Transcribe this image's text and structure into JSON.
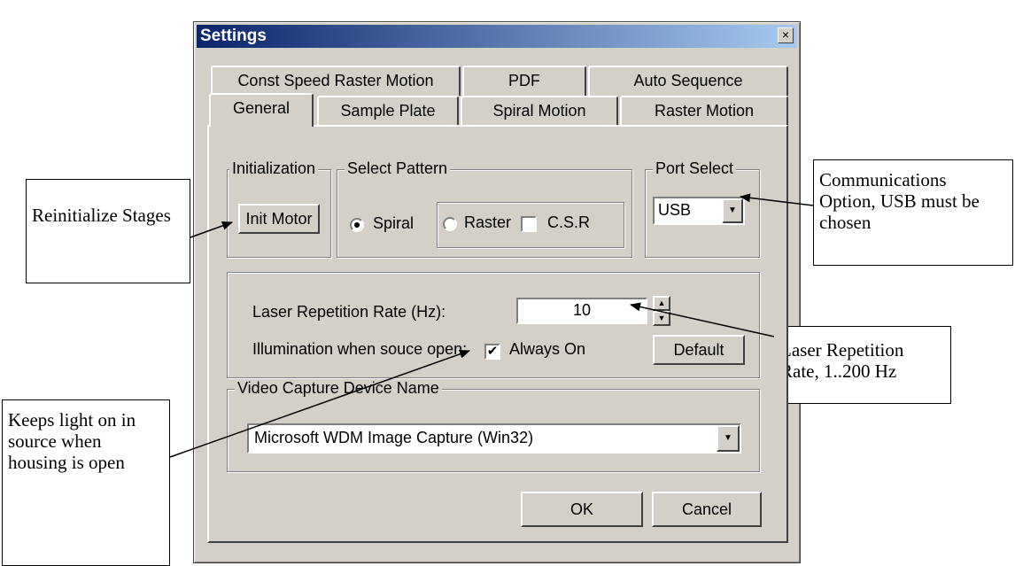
{
  "dialog": {
    "title": "Settings",
    "close_glyph": "×",
    "close_icon": "close-icon"
  },
  "tabs": {
    "row_back": [
      "Const Speed Raster Motion",
      "PDF",
      "Auto Sequence"
    ],
    "row_front": [
      "General",
      "Sample Plate",
      "Spiral Motion",
      "Raster Motion"
    ],
    "active": "General"
  },
  "initialization": {
    "label": "Initialization",
    "button": "Init Motor"
  },
  "select_pattern": {
    "label": "Select Pattern",
    "spiral": "Spiral",
    "raster": "Raster",
    "csr": "C.S.R",
    "selected": "Spiral",
    "csr_checked": false
  },
  "port_select": {
    "label": "Port Select",
    "value": "USB",
    "dropdown_icon": "chevron-down-icon"
  },
  "laser": {
    "rate_label": "Laser Repetition Rate (Hz):",
    "rate_value": "10",
    "illum_label": "Illumination when souce open:",
    "always_on_label": "Always On",
    "always_on_checked": true,
    "check_glyph": "✔",
    "default_button": "Default",
    "spin_up_glyph": "▲",
    "spin_down_glyph": "▼"
  },
  "video": {
    "label": "Video Capture Device Name",
    "value": "Microsoft WDM Image Capture (Win32)",
    "dropdown_glyph": "▼"
  },
  "footer": {
    "ok": "OK",
    "cancel": "Cancel"
  },
  "annotations": {
    "reinit": "Reinitialize Stages",
    "comm": "Communications Option, USB must be chosen",
    "laser": "Laser Repetition Rate, 1..200 Hz",
    "light": "Keeps light on in source when housing is open"
  }
}
